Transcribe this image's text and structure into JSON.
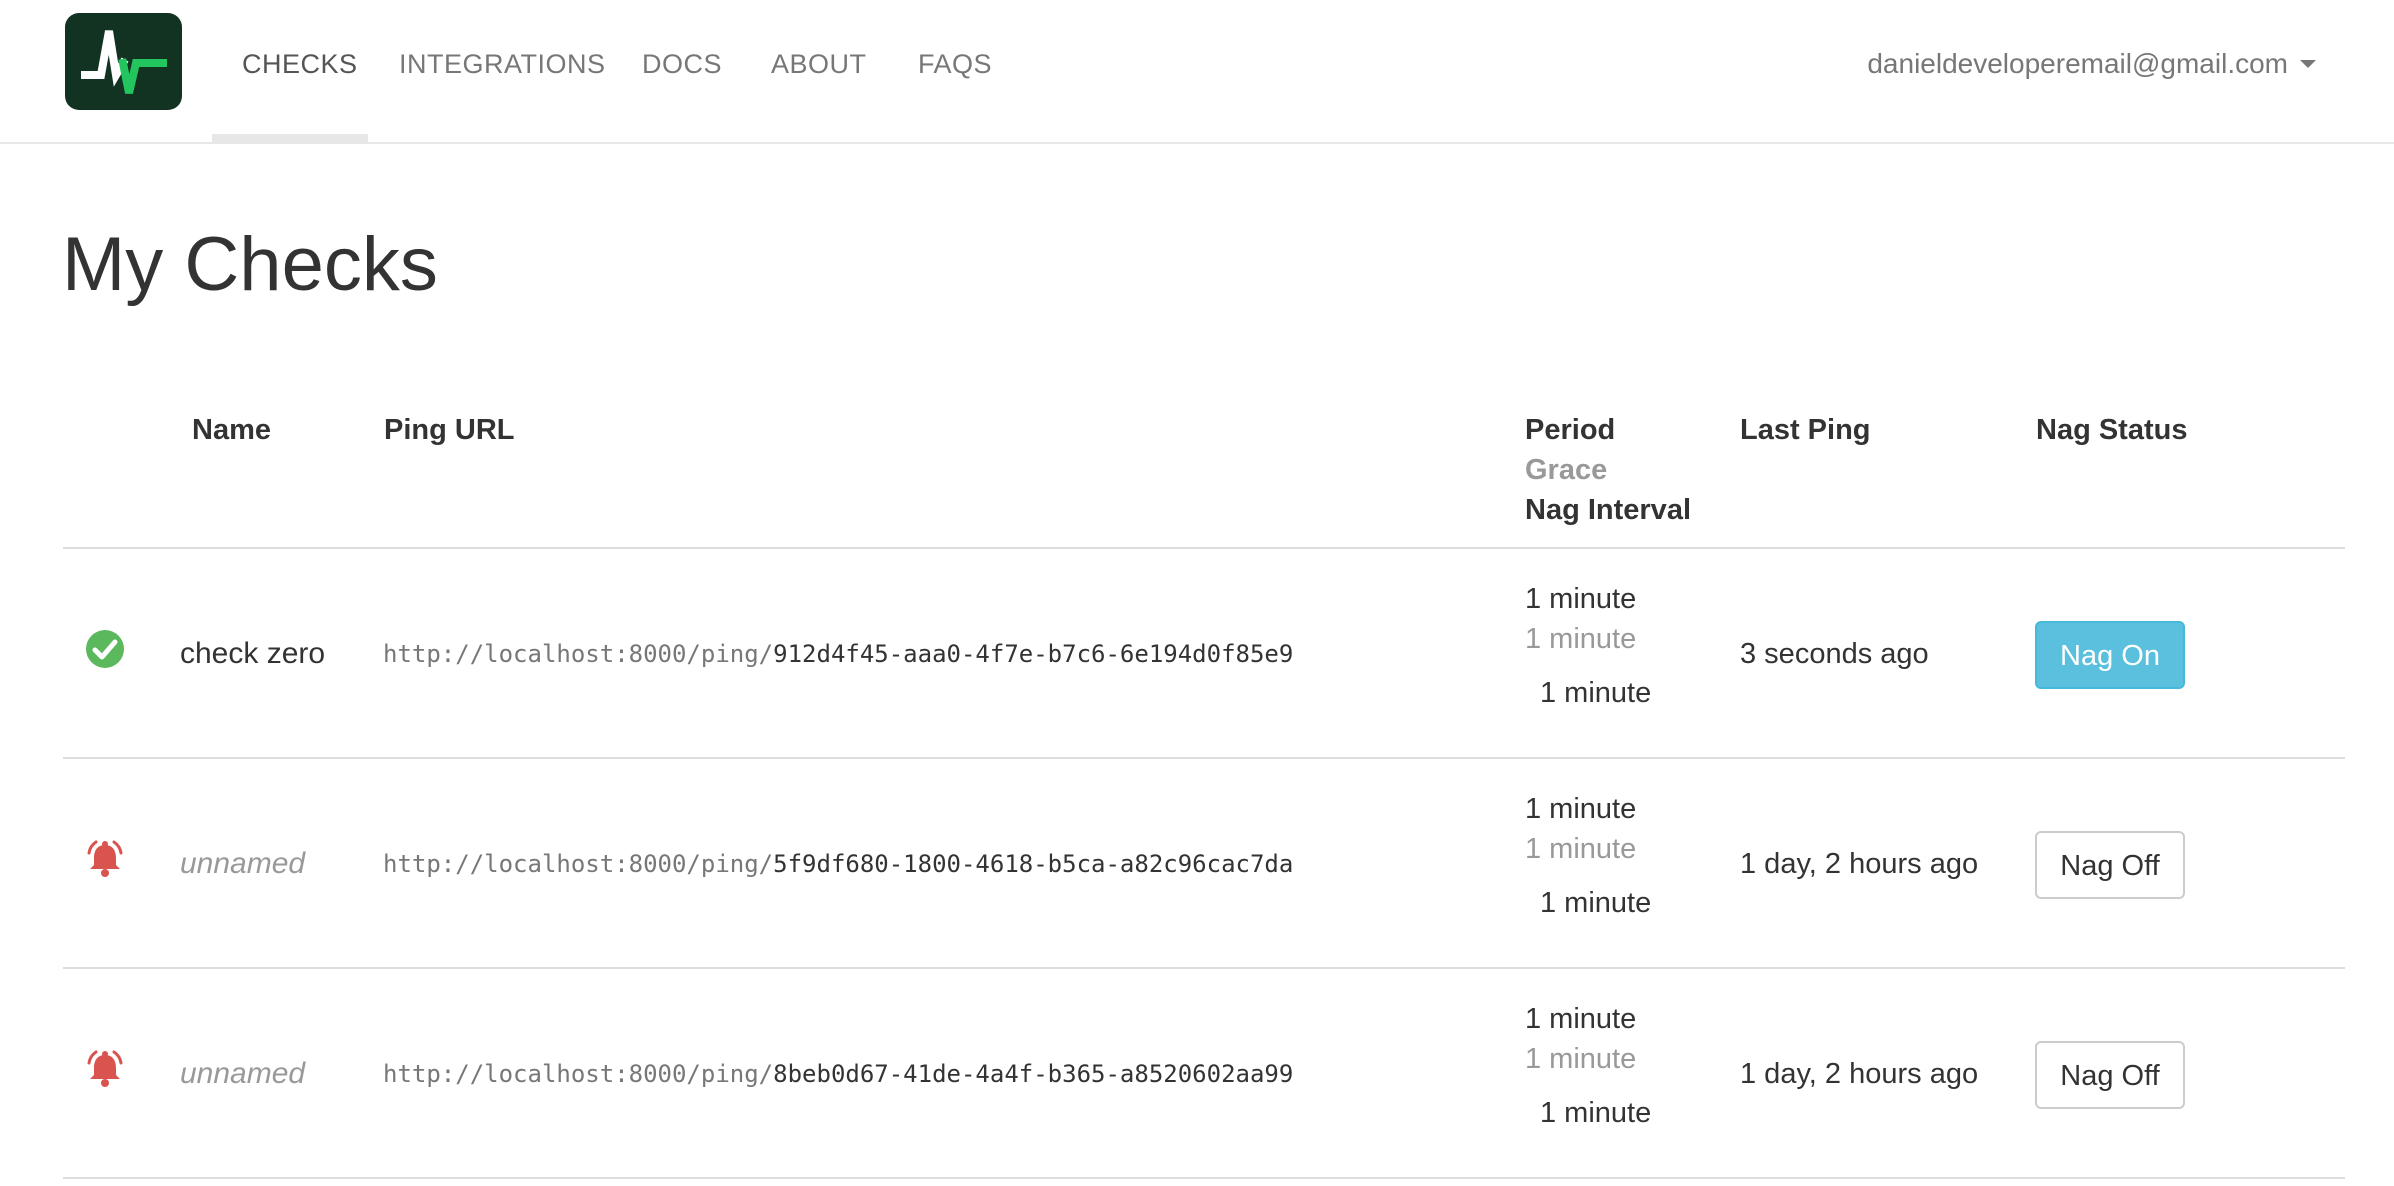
{
  "nav": {
    "items": [
      {
        "label": "CHECKS",
        "active": true
      },
      {
        "label": "INTEGRATIONS",
        "active": false
      },
      {
        "label": "DOCS",
        "active": false
      },
      {
        "label": "ABOUT",
        "active": false
      },
      {
        "label": "FAQS",
        "active": false
      }
    ],
    "user_email": "danieldeveloperemail@gmail.com"
  },
  "page": {
    "title": "My Checks"
  },
  "table": {
    "headers": {
      "name": "Name",
      "ping_url": "Ping URL",
      "period": "Period",
      "grace": "Grace",
      "nag_interval": "Nag Interval",
      "last_ping": "Last Ping",
      "nag_status": "Nag Status"
    },
    "rows": [
      {
        "status": "up",
        "status_icon": "check-circle-icon",
        "name": "check zero",
        "unnamed": false,
        "url_base": "http://localhost:8000/ping/",
        "url_code": "912d4f45-aaa0-4f7e-b7c6-6e194d0f85e9",
        "period": "1 minute",
        "grace": "1 minute",
        "nag_interval": "1 minute",
        "last_ping": "3 seconds ago",
        "nag_label": "Nag On",
        "nag_on": true
      },
      {
        "status": "nag",
        "status_icon": "alarm-bell-icon",
        "name": "unnamed",
        "unnamed": true,
        "url_base": "http://localhost:8000/ping/",
        "url_code": "5f9df680-1800-4618-b5ca-a82c96cac7da",
        "period": "1 minute",
        "grace": "1 minute",
        "nag_interval": "1 minute",
        "last_ping": "1 day, 2 hours ago",
        "nag_label": "Nag Off",
        "nag_on": false
      },
      {
        "status": "nag",
        "status_icon": "alarm-bell-icon",
        "name": "unnamed",
        "unnamed": true,
        "url_base": "http://localhost:8000/ping/",
        "url_code": "8beb0d67-41de-4a4f-b365-a8520602aa99",
        "period": "1 minute",
        "grace": "1 minute",
        "nag_interval": "1 minute",
        "last_ping": "1 day, 2 hours ago",
        "nag_label": "Nag Off",
        "nag_on": false
      }
    ]
  },
  "colors": {
    "up": "#5cb85c",
    "nag": "#d9534f",
    "nag_on_button": "#5bc0de",
    "logo_bg": "#123321"
  }
}
